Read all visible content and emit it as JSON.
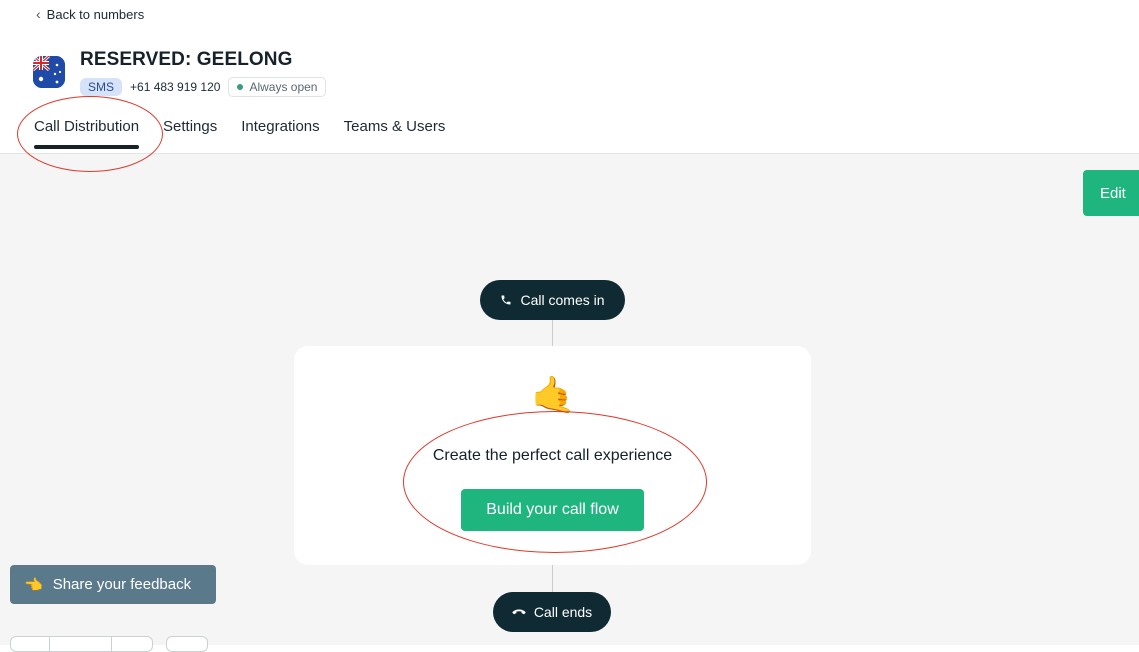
{
  "header": {
    "back_label": "Back to numbers",
    "title": "RESERVED: GEELONG",
    "sms_badge": "SMS",
    "phone": "+61 483 919 120",
    "status": "Always open"
  },
  "tabs": [
    {
      "label": "Call Distribution",
      "active": true
    },
    {
      "label": "Settings",
      "active": false
    },
    {
      "label": "Integrations",
      "active": false
    },
    {
      "label": "Teams & Users",
      "active": false
    }
  ],
  "toolbar": {
    "edit_label": "Edit"
  },
  "flow": {
    "start_label": "Call comes in",
    "end_label": "Call ends",
    "empty_emoji": "🤙",
    "empty_text": "Create the perfect call experience",
    "build_label": "Build your call flow"
  },
  "feedback": {
    "emoji": "👈",
    "label": "Share your feedback"
  },
  "colors": {
    "accent_green": "#1fb57f",
    "dark_pill": "#0f2a33",
    "feedback_bg": "#5a7a8b",
    "annotation_red": "#e0392b",
    "status_dot": "#3c9a7e"
  },
  "icons": {
    "back": "chevron-left-icon",
    "flag": "australia-flag-icon",
    "start": "phone-icon",
    "end": "hang-up-icon"
  }
}
